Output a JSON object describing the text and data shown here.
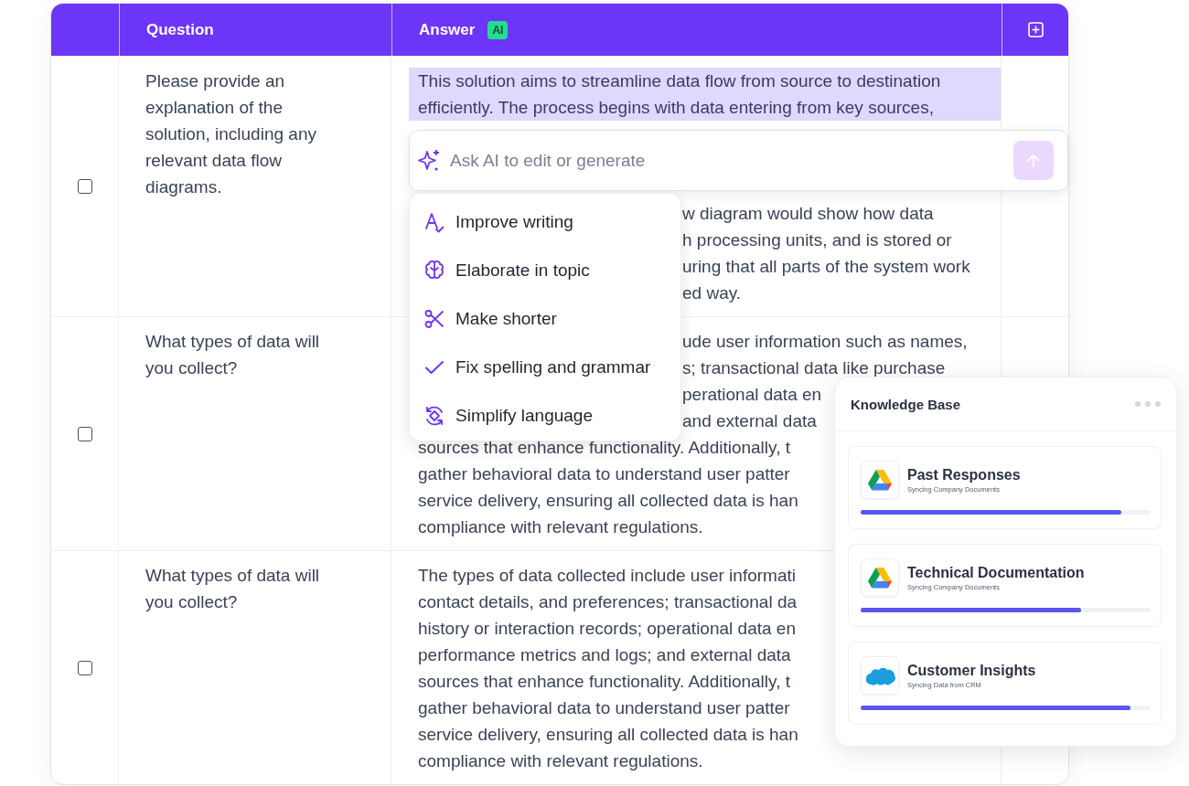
{
  "table": {
    "columns": [
      {
        "label": "Question"
      },
      {
        "label": "Answer",
        "badge": "AI"
      }
    ],
    "rows": [
      {
        "checked": false,
        "question": "Please provide an explanation of the solution, including any relevant data flow diagrams.",
        "answer_lines": [
          {
            "kind": "highlighted",
            "text": "This solution aims to streamline data flow from source to destination"
          },
          {
            "kind": "highlighted",
            "text": "efficiently. The process begins with data entering from key sources,"
          },
          {
            "kind": "beside_menu",
            "text": "w diagram would show how data"
          },
          {
            "kind": "beside_menu",
            "text": "h processing units, and is stored or"
          },
          {
            "kind": "beside_menu",
            "text": "uring that all parts of the system work"
          },
          {
            "kind": "beside_menu",
            "text": "ed way."
          }
        ]
      },
      {
        "checked": false,
        "question": "What types of data will you collect?",
        "answer_lines": [
          {
            "kind": "beside_menu",
            "text": "ude user information such as names,"
          },
          {
            "kind": "beside_menu",
            "text": "s; transactional data like purchase"
          },
          {
            "kind": "beside_menu",
            "text": "perational data en"
          },
          {
            "kind": "beside_menu",
            "text": "and external data"
          },
          {
            "kind": "plain",
            "text": "sources that enhance functionality. Additionally, t"
          },
          {
            "kind": "plain",
            "text": "gather behavioral data to understand user patter"
          },
          {
            "kind": "plain",
            "text": "service delivery, ensuring all collected data is han"
          },
          {
            "kind": "plain",
            "text": "compliance with relevant regulations."
          }
        ]
      },
      {
        "checked": false,
        "question": "What types of data will you collect?",
        "answer_lines": [
          {
            "kind": "plain",
            "text": "The types of data collected include user informati"
          },
          {
            "kind": "plain",
            "text": "contact details, and preferences; transactional da"
          },
          {
            "kind": "plain",
            "text": "history or interaction records; operational data en"
          },
          {
            "kind": "plain",
            "text": "performance metrics and logs; and external data"
          },
          {
            "kind": "plain",
            "text": "sources that enhance functionality. Additionally, t"
          },
          {
            "kind": "plain",
            "text": "gather behavioral data to understand user patter"
          },
          {
            "kind": "plain",
            "text": "service delivery, ensuring all collected data is han"
          },
          {
            "kind": "plain",
            "text": "compliance with relevant regulations."
          }
        ]
      }
    ]
  },
  "ai_prompt": {
    "placeholder": "Ask AI to edit or generate"
  },
  "ai_menu": [
    {
      "label": "Improve writing"
    },
    {
      "label": "Elaborate in topic"
    },
    {
      "label": "Make shorter"
    },
    {
      "label": "Fix spelling and grammar"
    },
    {
      "label": "Simplify language"
    }
  ],
  "knowledge_base": {
    "title": "Knowledge Base",
    "sources": [
      {
        "kind": "triangle",
        "title": "Past Responses",
        "subtitle": "Syncing Company Documents",
        "level": 0.9
      },
      {
        "kind": "triangle",
        "title": "Technical Documentation",
        "subtitle": "Syncing Company Documents",
        "level": 0.76
      },
      {
        "kind": "cloud",
        "title": "Customer Insights",
        "subtitle": "Syncing Data from CRM",
        "level": 0.93
      }
    ]
  }
}
